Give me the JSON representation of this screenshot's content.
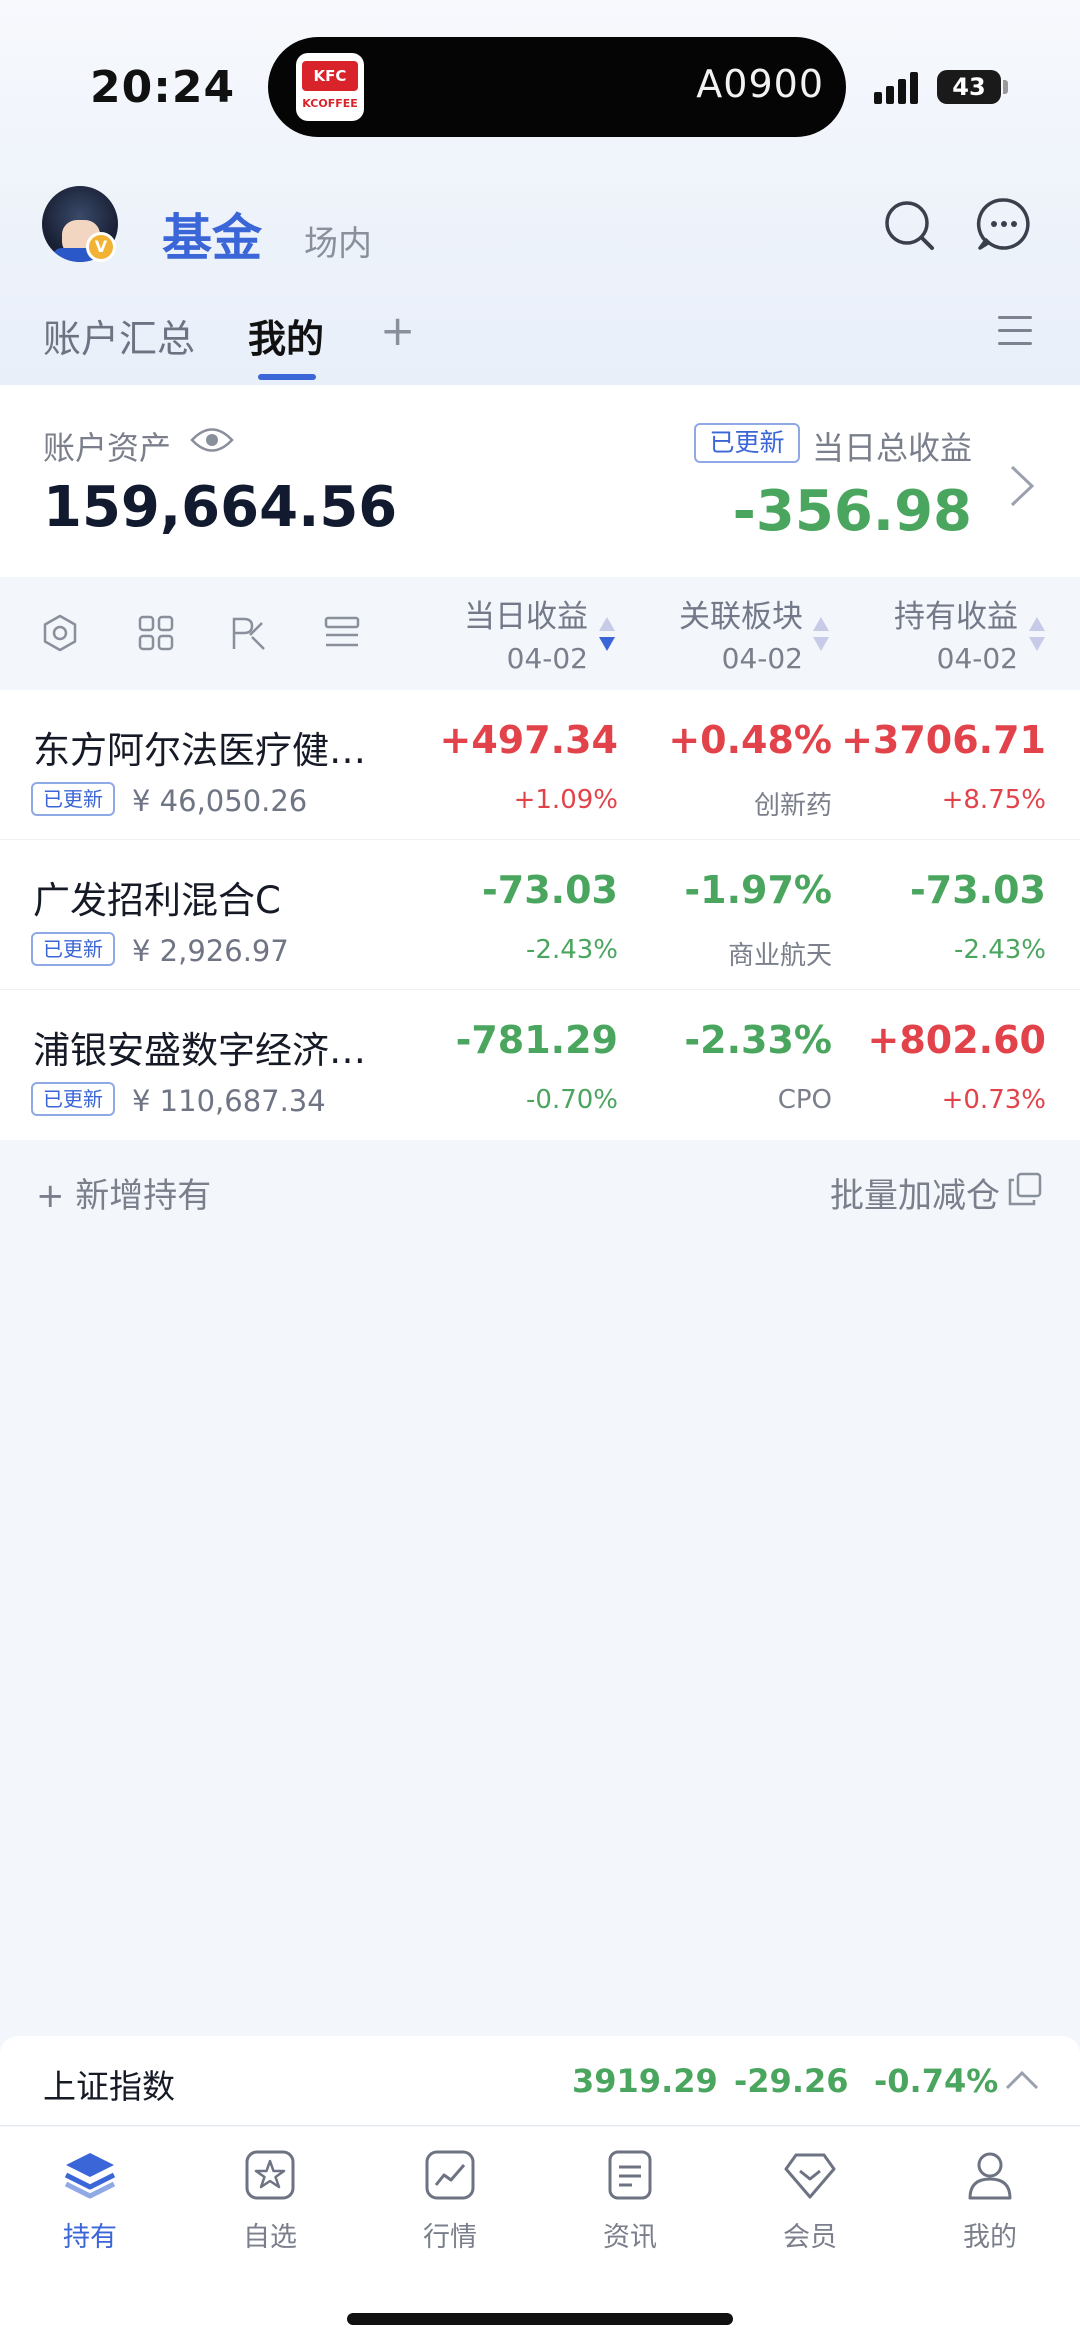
{
  "status_bar": {
    "time": "20:24",
    "island_text": "A0900",
    "island_logo_top": "KFC",
    "island_logo_bottom": "KCOFFEE",
    "battery": "43"
  },
  "header": {
    "tab_fund": "基金",
    "tab_market": "场内",
    "verified_badge": "V"
  },
  "subtabs": {
    "summary": "账户汇总",
    "mine": "我的",
    "plus": "+"
  },
  "asset": {
    "label": "账户资产",
    "value": "159,664.56",
    "updated_badge": "已更新",
    "day_label": "当日总收益",
    "day_value": "-356.98"
  },
  "table_header": {
    "col1": {
      "title": "当日收益",
      "date": "04-02"
    },
    "col2": {
      "title": "关联板块",
      "date": "04-02"
    },
    "col3": {
      "title": "持有收益",
      "date": "04-02"
    }
  },
  "funds": [
    {
      "name": "东方阿尔法医疗健…",
      "badge": "已更新",
      "holding": "¥ 46,050.26",
      "day_gain": "+497.34",
      "day_pct": "+1.09%",
      "sector_pct": "+0.48%",
      "sector": "创新药",
      "hold_gain": "+3706.71",
      "hold_pct": "+8.75%"
    },
    {
      "name": "广发招利混合C",
      "badge": "已更新",
      "holding": "¥ 2,926.97",
      "day_gain": "-73.03",
      "day_pct": "-2.43%",
      "sector_pct": "-1.97%",
      "sector": "商业航天",
      "hold_gain": "-73.03",
      "hold_pct": "-2.43%"
    },
    {
      "name": "浦银安盛数字经济…",
      "badge": "已更新",
      "holding": "¥ 110,687.34",
      "day_gain": "-781.29",
      "day_pct": "-0.70%",
      "sector_pct": "-2.33%",
      "sector": "CPO",
      "hold_gain": "+802.60",
      "hold_pct": "+0.73%"
    }
  ],
  "actions": {
    "add_holding": "+ 新增持有",
    "batch": "批量加减仓"
  },
  "index": {
    "name": "上证指数",
    "value": "3919.29",
    "change": "-29.26",
    "pct": "-0.74%"
  },
  "nav": [
    {
      "label": "持有",
      "icon": "layers-icon"
    },
    {
      "label": "自选",
      "icon": "star-icon"
    },
    {
      "label": "行情",
      "icon": "chart-icon"
    },
    {
      "label": "资讯",
      "icon": "document-icon"
    },
    {
      "label": "会员",
      "icon": "diamond-icon"
    },
    {
      "label": "我的",
      "icon": "user-icon"
    }
  ],
  "colors": {
    "accent": "#3b66d8",
    "up": "#e2434b",
    "down": "#4aa65e"
  }
}
